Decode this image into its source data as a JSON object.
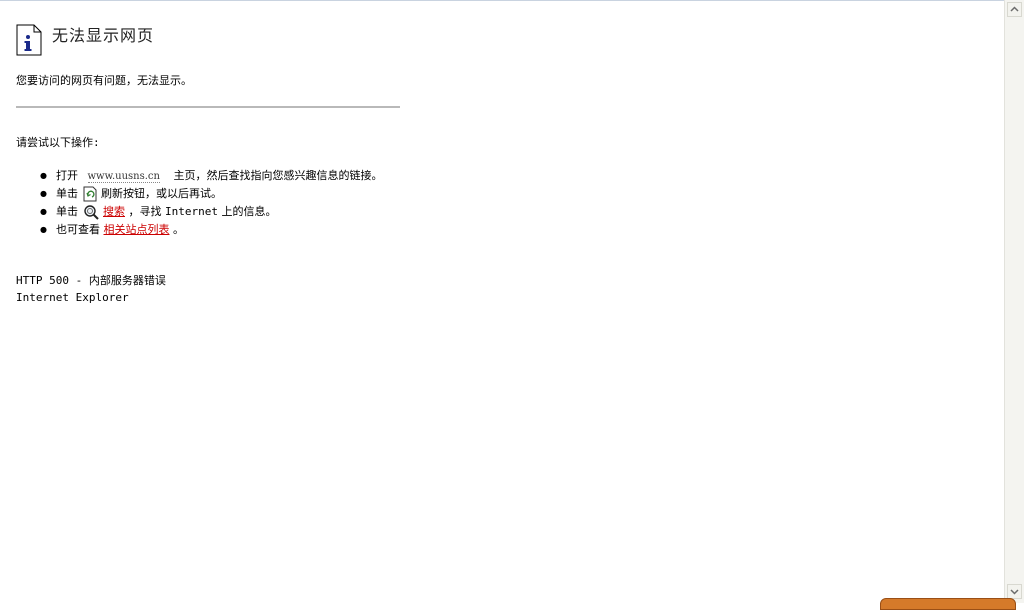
{
  "header": {
    "title": "无法显示网页"
  },
  "message": "您要访问的网页有问题，无法显示。",
  "instructions_heading": "请尝试以下操作:",
  "actions": [
    {
      "prefix": "打开",
      "url": "www.uusns.cn",
      "suffix": "主页，然后查找指向您感兴趣信息的链接。"
    },
    {
      "prefix": "单击",
      "suffix": "刷新按钮，或以后再试。",
      "icon": "refresh-icon"
    },
    {
      "prefix": "单击",
      "link": "搜索",
      "middle": "，寻找",
      "keyword": "Internet",
      "suffix": "上的信息。",
      "icon": "search-icon"
    },
    {
      "prefix": "也可查看",
      "link": "相关站点列表",
      "suffix": "。"
    }
  ],
  "error": {
    "code_line": "HTTP 500 - 内部服务器错误",
    "product": "Internet Explorer"
  },
  "colors": {
    "link": "#cc0000",
    "divider": "#b9b9b9"
  },
  "icons": {
    "info": "info-icon",
    "refresh": "refresh-icon",
    "search": "search-icon"
  }
}
